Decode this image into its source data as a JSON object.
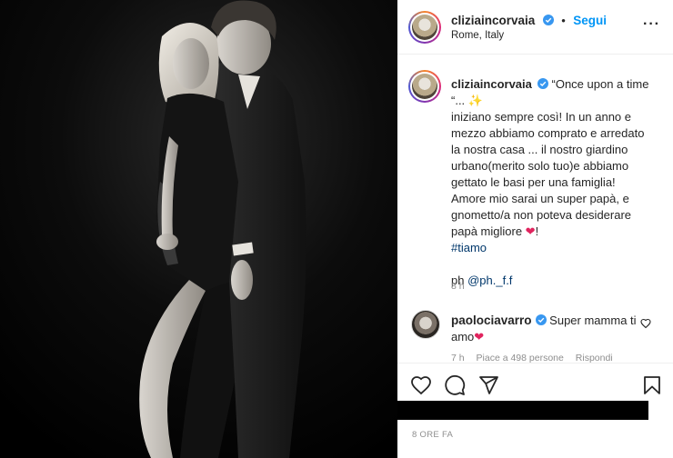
{
  "post": {
    "author": "cliziaincorvaia",
    "follow_label": "Segui",
    "location": "Rome, Italy",
    "more_icon": "more-dots-icon",
    "caption": {
      "username": "cliziaincorvaia",
      "line1": "“Once upon a time",
      "line2": "“... ✨",
      "line3": "iniziano sempre così! In un anno e",
      "line4": "mezzo abbiamo comprato e arredato",
      "line5": "la nostra casa ... il nostro giardino",
      "line6": "urbano(merito solo tuo)e abbiamo",
      "line7": "gettato le basi per una famiglia!",
      "line8": "Amore mio sarai un super papà, e",
      "line9": "gnometto/a non poteva desiderare",
      "line10_text": "papà migliore ",
      "line10_emoji": "❤",
      "line10_end": "!",
      "hashtag": "#tiamo",
      "credit_prefix": "ph ",
      "credit_mention": "@ph._f.f",
      "time": "8 h"
    },
    "reply": {
      "username": "paolociavarro",
      "text1": "Super mamma ti",
      "text2": "amo",
      "emoji": "❤",
      "time": "7 h",
      "likes": "Piace a 498 persone",
      "reply_label": "Rispondi"
    },
    "post_time": "8 ORE FA"
  },
  "icons": {
    "like": "heart-outline-icon",
    "comment": "comment-bubble-icon",
    "share": "paper-plane-icon",
    "save": "bookmark-icon"
  },
  "colors": {
    "link_blue": "#0095f6",
    "hashtag_blue": "#00376b",
    "meta_gray": "#8e8e8e",
    "text": "#262626"
  }
}
